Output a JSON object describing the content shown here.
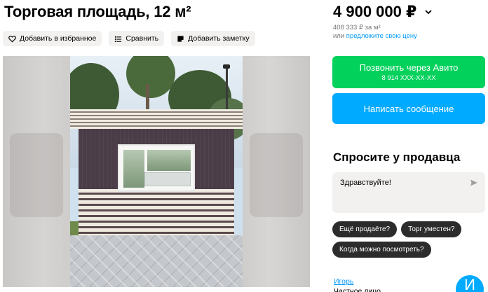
{
  "listing": {
    "title": "Торговая площадь, 12 м²"
  },
  "actions": {
    "favorite": "Добавить в избранное",
    "compare": "Сравнить",
    "note": "Добавить заметку"
  },
  "icons": {
    "favorite": "heart-icon",
    "compare": "compare-icon",
    "note": "note-icon",
    "price_dropdown": "chevron-down-icon",
    "send": "send-icon"
  },
  "price": {
    "value": "4 900 000 ₽",
    "per_meter": "408 333 ₽ за м²",
    "offer_prefix": "или ",
    "offer_link": "предложите свою цену"
  },
  "contact": {
    "call_label": "Позвонить через Авито",
    "call_phone": "8 914 XXX-XX-XX",
    "message_label": "Написать сообщение"
  },
  "ask": {
    "title": "Спросите у продавца",
    "input_value": "Здравствуйте!",
    "chips": [
      "Ещё продаёте?",
      "Торг уместен?",
      "Когда можно посмотреть?"
    ]
  },
  "seller": {
    "name": "Игорь",
    "type": "Частное лицо",
    "avatar_letter": "И"
  },
  "colors": {
    "call_button": "#02d15c",
    "message_button": "#00aaff",
    "link": "#0099f7",
    "chip": "#2c2c2c"
  }
}
